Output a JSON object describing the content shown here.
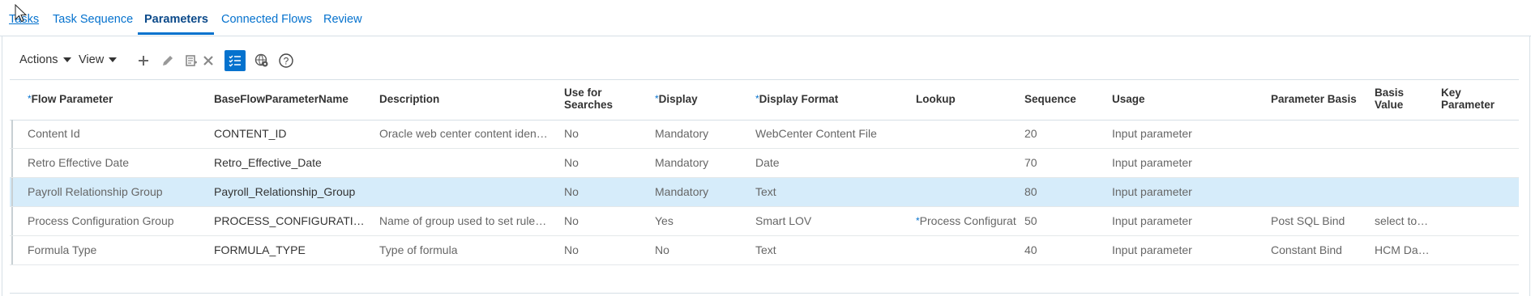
{
  "tabs": [
    {
      "label": "Tasks"
    },
    {
      "label": "Task Sequence"
    },
    {
      "label": "Parameters"
    },
    {
      "label": "Connected Flows"
    },
    {
      "label": "Review"
    }
  ],
  "toolbar": {
    "actions_label": "Actions",
    "view_label": "View",
    "icons": [
      "add-icon",
      "edit-icon",
      "duplicate-icon",
      "delete-icon",
      "checklist-icon",
      "globe-settings-icon",
      "help-icon"
    ]
  },
  "table": {
    "columns": [
      {
        "label": "Flow Parameter",
        "required": true
      },
      {
        "label": "BaseFlowParameterName",
        "required": false
      },
      {
        "label": "Description",
        "required": false
      },
      {
        "label": "Use for Searches",
        "required": false
      },
      {
        "label": "Display",
        "required": true
      },
      {
        "label": "Display Format",
        "required": true
      },
      {
        "label": "Lookup",
        "required": false
      },
      {
        "label": "Sequence",
        "required": false
      },
      {
        "label": "Usage",
        "required": false
      },
      {
        "label": "Parameter Basis",
        "required": false
      },
      {
        "label": "Basis Value",
        "required": false
      },
      {
        "label": "Key Parameter",
        "required": false
      }
    ],
    "rows": [
      {
        "flow_parameter": "Content Id",
        "base_name": "CONTENT_ID",
        "description": "Oracle web center content iden…",
        "use_for_searches": "No",
        "display": "Mandatory",
        "display_format": "WebCenter Content File",
        "lookup": "",
        "sequence": "20",
        "usage": "Input parameter",
        "parameter_basis": "",
        "basis_value": "",
        "key_parameter": "",
        "selected": false
      },
      {
        "flow_parameter": "Retro Effective Date",
        "base_name": "Retro_Effective_Date",
        "description": "",
        "use_for_searches": "No",
        "display": "Mandatory",
        "display_format": "Date",
        "lookup": "",
        "sequence": "70",
        "usage": "Input parameter",
        "parameter_basis": "",
        "basis_value": "",
        "key_parameter": "",
        "selected": false
      },
      {
        "flow_parameter": "Payroll Relationship Group",
        "base_name": "Payroll_Relationship_Group",
        "description": "",
        "use_for_searches": "No",
        "display": "Mandatory",
        "display_format": "Text",
        "lookup": "",
        "sequence": "80",
        "usage": "Input parameter",
        "parameter_basis": "",
        "basis_value": "",
        "key_parameter": "",
        "selected": true
      },
      {
        "flow_parameter": "Process Configuration Group",
        "base_name": "PROCESS_CONFIGURATI…",
        "description": "Name of group used to set rule…",
        "use_for_searches": "No",
        "display": "Yes",
        "display_format": "Smart LOV",
        "lookup": "Process Configurat",
        "lookup_required": true,
        "sequence": "50",
        "usage": "Input parameter",
        "parameter_basis": "Post SQL Bind",
        "basis_value": "select to…",
        "key_parameter": "",
        "selected": false
      },
      {
        "flow_parameter": "Formula Type",
        "base_name": "FORMULA_TYPE",
        "description": "Type of formula",
        "use_for_searches": "No",
        "display": "No",
        "display_format": "Text",
        "lookup": "",
        "sequence": "40",
        "usage": "Input parameter",
        "parameter_basis": "Constant Bind",
        "basis_value": "HCM Da…",
        "key_parameter": "",
        "selected": false
      }
    ]
  },
  "colors": {
    "link": "#0572ce",
    "selected_row": "#d6ecfa",
    "active_tab": "#0c4a8a"
  }
}
